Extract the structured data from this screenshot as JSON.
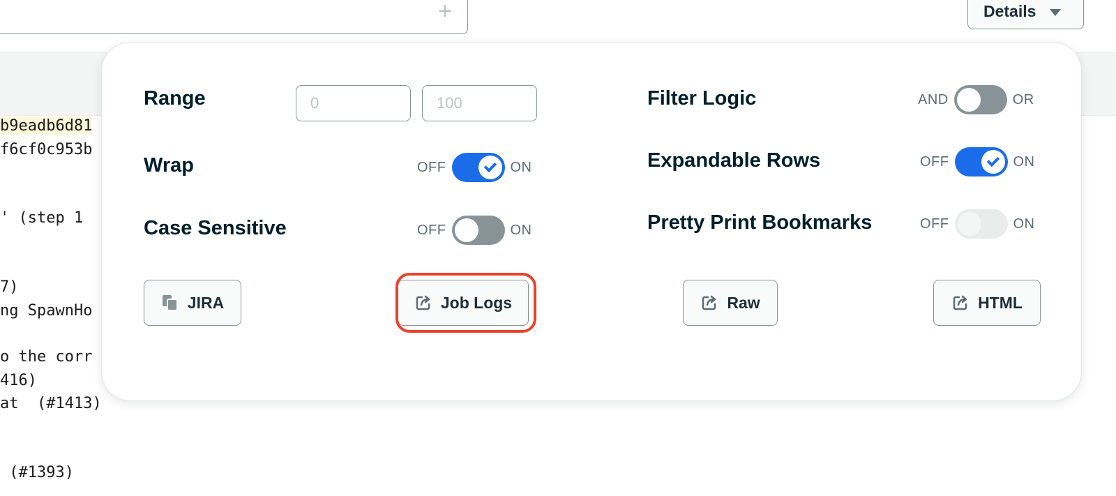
{
  "toolbar": {
    "add_symbol": "+",
    "details_label": "Details"
  },
  "log_lines": [
    {
      "text": "b9eadb6d81",
      "highlighted": true
    },
    {
      "text": "f6cf0c953b",
      "highlighted": false
    },
    {
      "text": "' (step 1",
      "highlighted": false
    },
    {
      "text": "7)",
      "highlighted": false
    },
    {
      "text": "ng SpawnHo",
      "highlighted": false
    },
    {
      "text": "o the corr",
      "highlighted": false
    },
    {
      "text": "416)",
      "highlighted": false
    },
    {
      "text": "at  (#1413)",
      "highlighted": false
    },
    {
      "text": " (#1393)",
      "highlighted": false
    }
  ],
  "settings": {
    "range": {
      "label": "Range",
      "start_placeholder": "0",
      "end_placeholder": "100"
    },
    "wrap": {
      "label": "Wrap",
      "off_text": "OFF",
      "on_text": "ON",
      "state": "on"
    },
    "case_sensitive": {
      "label": "Case Sensitive",
      "off_text": "OFF",
      "on_text": "ON",
      "state": "off"
    },
    "filter_logic": {
      "label": "Filter Logic",
      "off_text": "AND",
      "on_text": "OR",
      "state": "off"
    },
    "expandable_rows": {
      "label": "Expandable Rows",
      "off_text": "OFF",
      "on_text": "ON",
      "state": "on"
    },
    "pretty_print": {
      "label": "Pretty Print Bookmarks",
      "off_text": "OFF",
      "on_text": "ON",
      "state": "disabled"
    }
  },
  "actions": {
    "jira": {
      "label": "JIRA",
      "icon": "copy-icon"
    },
    "job_logs": {
      "label": "Job Logs",
      "icon": "external-link-icon"
    },
    "raw": {
      "label": "Raw",
      "icon": "external-link-icon"
    },
    "html": {
      "label": "HTML",
      "icon": "external-link-icon"
    }
  },
  "colors": {
    "toggle_on": "#1a6ce8",
    "toggle_off": "#889397",
    "highlight_ring": "#e8432e",
    "log_highlight": "#fef7d9"
  }
}
